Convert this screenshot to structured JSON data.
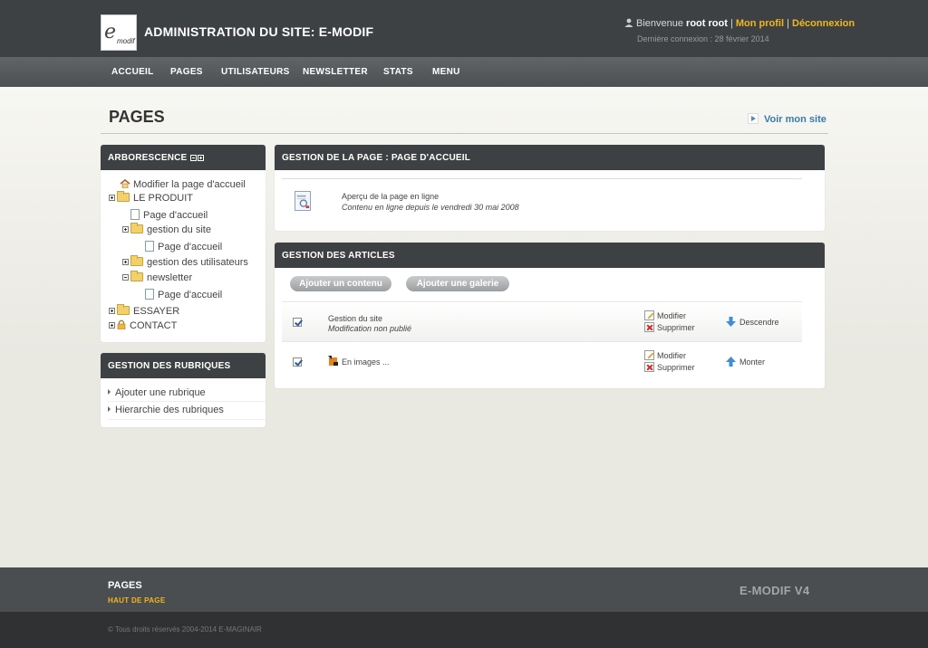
{
  "header": {
    "logo_letter": "e",
    "logo_text": "modif",
    "site_title": "ADMINISTRATION DU SITE: E-MODIF",
    "welcome_prefix": "Bienvenue ",
    "user_name": "root root",
    "sep": "|",
    "profile_link": "Mon profil",
    "logout_link": "Déconnexion",
    "last_login": "Dernière connexion : 28 février 2014"
  },
  "nav": {
    "items": [
      "ACCUEIL",
      "PAGES",
      "UTILISATEURS",
      "NEWSLETTER",
      "STATS",
      "MENU"
    ]
  },
  "main": {
    "page_title": "PAGES",
    "view_site_link": "Voir mon site"
  },
  "sidebar": {
    "tree_title": "ARBORESCENCE",
    "tree": [
      "Modifier la page d'accueil",
      "LE PRODUIT",
      "Page d'accueil",
      "gestion du site",
      "Page d'accueil",
      "gestion des utilisateurs",
      "newsletter",
      "Page d'accueil",
      "ESSAYER",
      "CONTACT"
    ],
    "rubriques_title": "GESTION DES RUBRIQUES",
    "rubriques": [
      "Ajouter une rubrique",
      "Hierarchie des rubriques"
    ]
  },
  "page_panel": {
    "title": "GESTION DE LA PAGE : PAGE D'ACCUEIL",
    "preview_label": "Aperçu de la page en ligne",
    "online_since": "Contenu en ligne depuis le vendredi 30 mai 2008"
  },
  "articles_panel": {
    "title": "GESTION DES ARTICLES",
    "add_content_button": "Ajouter un contenu",
    "add_gallery_button": "Ajouter une galerie",
    "rows": [
      {
        "title": "Gestion du site",
        "status": "Modification non publié",
        "edit": "Modifier",
        "delete": "Supprimer",
        "move": "Descendre"
      },
      {
        "title": "En images ...",
        "status": "",
        "edit": "Modifier",
        "delete": "Supprimer",
        "move": "Monter"
      }
    ]
  },
  "footer": {
    "title": "PAGES",
    "top_link": "HAUT DE PAGE",
    "version": "E-MODIF V4",
    "copyright": "© Tous droits réservés 2004-2014 E-MAGINAIR"
  },
  "colors": {
    "header_bg": "#3e4143",
    "nav_bg": "#575a5c",
    "accent_link": "#f1b71c",
    "blue_link": "#3a7ab0"
  }
}
